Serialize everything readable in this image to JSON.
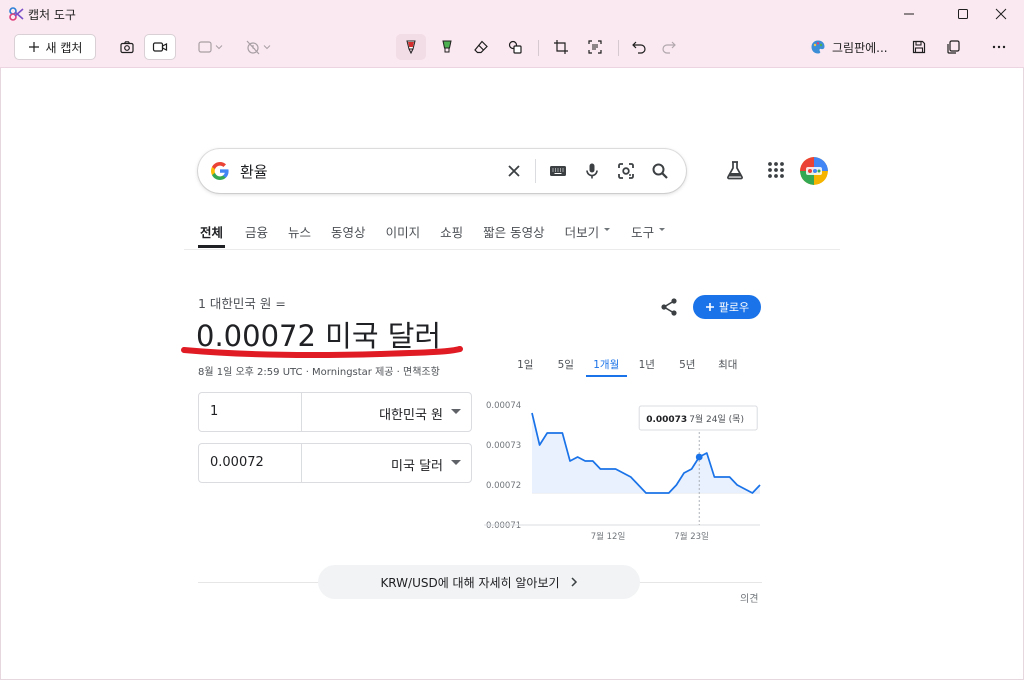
{
  "window": {
    "title": "캡처 도구"
  },
  "toolbar": {
    "new_capture_label": "새 캡처",
    "paint_label": "그림판에..."
  },
  "search": {
    "query": "환율"
  },
  "tabs": [
    {
      "label": "전체",
      "active": true
    },
    {
      "label": "금융"
    },
    {
      "label": "뉴스"
    },
    {
      "label": "동영상"
    },
    {
      "label": "이미지"
    },
    {
      "label": "쇼핑"
    },
    {
      "label": "짧은 동영상"
    },
    {
      "label": "더보기",
      "dropdown": true
    },
    {
      "label": "도구",
      "dropdown": true
    }
  ],
  "converter": {
    "from_label": "1 대한민국 원 =",
    "result": "0.00072 미국 달러",
    "meta": "8월 1일 오후 2:59 UTC · Morningstar 제공 · 면책조항",
    "follow_label": "팔로우",
    "from_value": "1",
    "from_currency": "대한민국 원",
    "to_value": "0.00072",
    "to_currency": "미국 달러"
  },
  "chart_ranges": [
    "1일",
    "5일",
    "1개월",
    "1년",
    "5년",
    "최대"
  ],
  "chart_active_range": "1개월",
  "chart_data": {
    "type": "area",
    "x": [
      "7월 2일",
      "7월 3일",
      "7월 4일",
      "7월 5일",
      "7월 6일",
      "7월 7일",
      "7월 8일",
      "7월 9일",
      "7월 10일",
      "7월 11일",
      "7월 12일",
      "7월 13일",
      "7월 14일",
      "7월 15일",
      "7월 16일",
      "7월 17일",
      "7월 18일",
      "7월 19일",
      "7월 20일",
      "7월 21일",
      "7월 22일",
      "7월 23일",
      "7월 24일",
      "7월 25일",
      "7월 26일",
      "7월 27일",
      "7월 28일",
      "7월 29일",
      "7월 30일",
      "7월 31일",
      "8월 1일"
    ],
    "values": [
      0.000738,
      0.00073,
      0.000733,
      0.000733,
      0.000733,
      0.000726,
      0.000727,
      0.000726,
      0.000726,
      0.000724,
      0.000724,
      0.000724,
      0.000723,
      0.000722,
      0.00072,
      0.000718,
      0.000718,
      0.000718,
      0.000718,
      0.00072,
      0.000723,
      0.000724,
      0.000727,
      0.000728,
      0.000722,
      0.000722,
      0.000722,
      0.00072,
      0.000719,
      0.000718,
      0.00072
    ],
    "x_ticks": [
      "7월 12일",
      "7월 23일"
    ],
    "y_ticks": [
      "0.00074",
      "0.00073",
      "0.00072",
      "0.00071"
    ],
    "ylim": [
      0.00071,
      0.00074
    ],
    "baseline": 0.000718,
    "tooltip": {
      "value": "0.00073",
      "date": "7월 24일 (목)"
    },
    "line_color": "#1a73e8",
    "grid": false
  },
  "more_button_label": "KRW/USD에 대해 자세히 알아보기",
  "feedback_label": "의견"
}
